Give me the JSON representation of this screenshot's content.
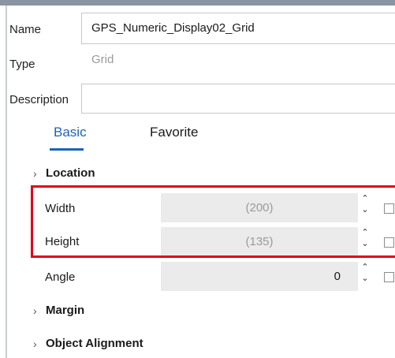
{
  "form": {
    "name_label": "Name",
    "name_value": "GPS_Numeric_Display02_Grid",
    "type_label": "Type",
    "type_value": "Grid",
    "description_label": "Description",
    "description_value": ""
  },
  "tabs": [
    {
      "label": "Basic",
      "active": true
    },
    {
      "label": "Favorite",
      "active": false
    }
  ],
  "sections": {
    "location": "Location",
    "margin": "Margin",
    "object_alignment": "Object Alignment"
  },
  "properties": [
    {
      "label": "Width",
      "value": "(200)"
    },
    {
      "label": "Height",
      "value": "(135)"
    },
    {
      "label": "Angle",
      "value": "0"
    }
  ],
  "icons": {
    "expand": "chevron-right-icon",
    "spin_up": "caret-up-icon",
    "spin_down": "caret-down-icon"
  },
  "colors": {
    "accent": "#1b63b8",
    "highlight": "#e2001a"
  }
}
